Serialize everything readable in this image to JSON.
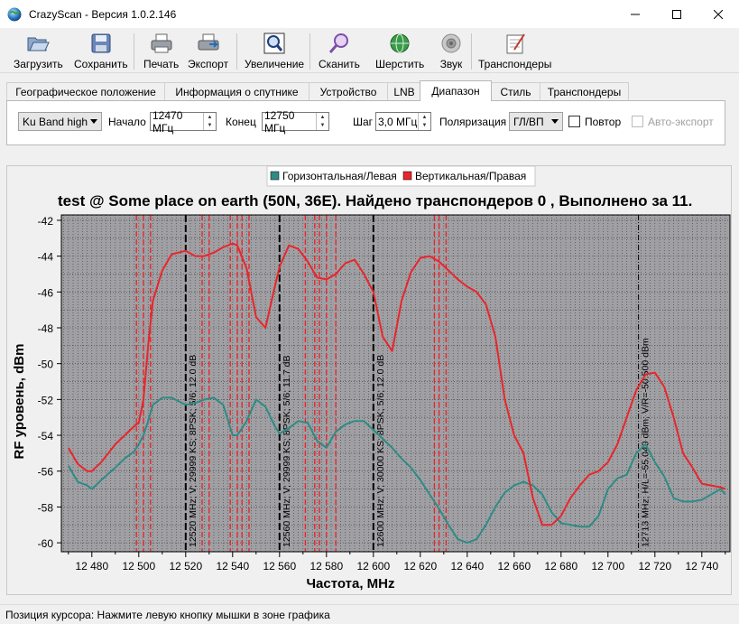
{
  "window": {
    "title": "CrazyScan - Версия 1.0.2.146"
  },
  "toolbar": {
    "items": [
      {
        "label": "Загрузить",
        "icon": "folder-open-icon"
      },
      {
        "label": "Сохранить",
        "icon": "floppy-disk-icon"
      },
      {
        "label": "Печать",
        "icon": "printer-icon"
      },
      {
        "label": "Экспорт",
        "icon": "export-printer-icon"
      },
      {
        "label": "Увеличение",
        "icon": "zoom-frame-icon"
      },
      {
        "label": "Сканить",
        "icon": "magnifier-icon"
      },
      {
        "label": "Шерстить",
        "icon": "globe-scan-icon"
      },
      {
        "label": "Звук",
        "icon": "speaker-icon"
      },
      {
        "label": "Транспондеры",
        "icon": "notebook-pencil-icon"
      }
    ]
  },
  "tabs": [
    {
      "label": "Географическое положение"
    },
    {
      "label": "Информация о спутнике"
    },
    {
      "label": "Устройство"
    },
    {
      "label": "LNB"
    },
    {
      "label": "Диапазон",
      "active": true
    },
    {
      "label": "Стиль"
    },
    {
      "label": "Транспондеры"
    }
  ],
  "range_panel": {
    "band": "Ku Band high",
    "start_label": "Начало",
    "start_value": "12470 МГц",
    "end_label": "Конец",
    "end_value": "12750 МГц",
    "step_label": "Шаг",
    "step_value": "3,0 МГц",
    "polarization_label": "Поляризация",
    "polarization_value": "ГЛ/ВП",
    "repeat_label": "Повтор",
    "auto_export_label": "Авто-экспорт"
  },
  "colors": {
    "horizontal": "#2e8b86",
    "vertical": "#e8262b",
    "plot_bg": "#a0a0a4"
  },
  "status": {
    "text": "Позиция курсора: Нажмите левую кнопку мышки в зоне графика"
  },
  "chart_data": {
    "type": "line",
    "title": "test @ Some place on earth (50N, 36E). Найдено транспондеров 0 , Выполнено за 11.",
    "xlabel": "Частота, MHz",
    "ylabel": "RF уровень, dBm",
    "xlim": [
      12467,
      12752
    ],
    "ylim": [
      -60.5,
      -41.7
    ],
    "x_ticks": [
      12480,
      12500,
      12520,
      12540,
      12560,
      12580,
      12600,
      12620,
      12640,
      12660,
      12680,
      12700,
      12720,
      12740
    ],
    "x_tick_labels": [
      "12 480",
      "12 500",
      "12 520",
      "12 540",
      "12 560",
      "12 580",
      "12 600",
      "12 620",
      "12 640",
      "12 660",
      "12 680",
      "12 700",
      "12 720",
      "12 740"
    ],
    "y_ticks": [
      -42,
      -44,
      -46,
      -48,
      -50,
      -52,
      -54,
      -56,
      -58,
      -60
    ],
    "legend": {
      "position": "top-center",
      "entries": [
        "Горизонтальная/Левая",
        "Вертикальная/Правая"
      ]
    },
    "grid": true,
    "series": [
      {
        "name": "Горизонтальная/Левая",
        "color": "#2e8b86",
        "x": [
          12470,
          12474,
          12478,
          12480,
          12484,
          12490,
          12494,
          12498,
          12500,
          12502,
          12504,
          12506,
          12510,
          12514,
          12520,
          12524,
          12528,
          12532,
          12536,
          12540,
          12542,
          12546,
          12550,
          12554,
          12558,
          12560,
          12564,
          12568,
          12572,
          12576,
          12580,
          12584,
          12588,
          12592,
          12596,
          12600,
          12604,
          12608,
          12612,
          12616,
          12620,
          12624,
          12628,
          12632,
          12636,
          12640,
          12644,
          12648,
          12652,
          12656,
          12660,
          12664,
          12668,
          12672,
          12676,
          12680,
          12684,
          12688,
          12692,
          12696,
          12700,
          12704,
          12708,
          12712,
          12716,
          12720,
          12724,
          12728,
          12732,
          12736,
          12740,
          12744,
          12748,
          12750
        ],
        "y": [
          -55.7,
          -56.6,
          -56.8,
          -57.0,
          -56.5,
          -55.8,
          -55.3,
          -54.9,
          -54.5,
          -54.0,
          -53.2,
          -52.3,
          -51.9,
          -51.9,
          -52.3,
          -52.2,
          -52.0,
          -51.9,
          -52.3,
          -54.0,
          -54.0,
          -53.2,
          -52.0,
          -52.4,
          -53.5,
          -53.9,
          -53.6,
          -53.2,
          -53.3,
          -54.3,
          -54.7,
          -53.8,
          -53.4,
          -53.2,
          -53.2,
          -53.7,
          -54.2,
          -54.7,
          -55.3,
          -55.8,
          -56.5,
          -57.3,
          -58.1,
          -59.0,
          -59.8,
          -60.0,
          -59.8,
          -59.0,
          -58.0,
          -57.2,
          -56.8,
          -56.6,
          -56.8,
          -57.3,
          -58.3,
          -58.9,
          -59.0,
          -59.1,
          -59.1,
          -58.5,
          -57.0,
          -56.4,
          -56.2,
          -55.0,
          -54.5,
          -55.5,
          -56.3,
          -57.5,
          -57.7,
          -57.7,
          -57.6,
          -57.3,
          -57.0,
          -57.3
        ]
      },
      {
        "name": "Вертикальная/Правая",
        "color": "#e8262b",
        "x": [
          12470,
          12474,
          12478,
          12480,
          12484,
          12490,
          12494,
          12498,
          12500,
          12502,
          12504,
          12506,
          12510,
          12514,
          12520,
          12524,
          12528,
          12532,
          12536,
          12540,
          12542,
          12546,
          12550,
          12554,
          12558,
          12560,
          12564,
          12568,
          12572,
          12576,
          12580,
          12584,
          12588,
          12592,
          12596,
          12600,
          12604,
          12608,
          12612,
          12616,
          12620,
          12624,
          12628,
          12632,
          12636,
          12640,
          12644,
          12648,
          12652,
          12656,
          12660,
          12664,
          12668,
          12672,
          12676,
          12680,
          12684,
          12688,
          12692,
          12696,
          12700,
          12704,
          12708,
          12712,
          12716,
          12720,
          12724,
          12728,
          12732,
          12736,
          12740,
          12744,
          12748,
          12750
        ],
        "y": [
          -54.7,
          -55.6,
          -56.0,
          -56.0,
          -55.5,
          -54.5,
          -54.0,
          -53.5,
          -53.3,
          -52.0,
          -49.0,
          -46.5,
          -44.8,
          -43.9,
          -43.7,
          -44.0,
          -44.0,
          -43.8,
          -43.5,
          -43.3,
          -43.4,
          -44.7,
          -47.4,
          -48.0,
          -45.7,
          -44.6,
          -43.4,
          -43.6,
          -44.3,
          -45.2,
          -45.3,
          -45.0,
          -44.4,
          -44.2,
          -45.0,
          -46.0,
          -48.5,
          -49.3,
          -46.5,
          -44.9,
          -44.1,
          -44.0,
          -44.3,
          -44.8,
          -45.3,
          -45.7,
          -46.0,
          -46.7,
          -48.5,
          -52.0,
          -54.0,
          -55.0,
          -57.5,
          -59.0,
          -59.0,
          -58.5,
          -57.5,
          -56.8,
          -56.2,
          -56.0,
          -55.5,
          -54.5,
          -53.0,
          -51.5,
          -50.6,
          -50.5,
          -51.3,
          -53.0,
          -55.0,
          -55.8,
          -56.7,
          -56.8,
          -56.9,
          -57.0
        ]
      }
    ],
    "transponder_markers": [
      {
        "freq": 12520,
        "label": "12520 MHz; V; 29999 KS; 8PSK; 5/6; 12.0 dB"
      },
      {
        "freq": 12560,
        "label": "12560 MHz; V; 29999 KS; 8PSK; 5/6; 11.7 dB"
      },
      {
        "freq": 12600,
        "label": "12600 MHz; V; 30000 KS; 8PSK; 5/6; 12.0 dB"
      },
      {
        "freq": 12713,
        "label": "12713 MHz; H/L=-55.040 dBm; V/R=-50.500 dBm"
      }
    ],
    "red_band_lines": [
      12499,
      12502,
      12505,
      12527,
      12530,
      12539,
      12542,
      12544,
      12547,
      12571,
      12575,
      12577,
      12580,
      12584,
      12626,
      12628,
      12631
    ]
  }
}
